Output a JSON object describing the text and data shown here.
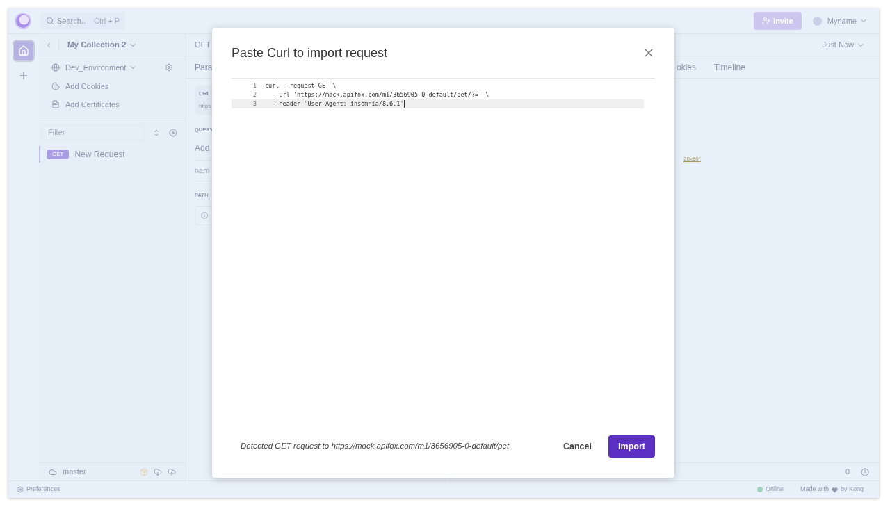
{
  "topbar": {
    "search": {
      "placeholder": "Search..",
      "shortcut": "Ctrl + P"
    },
    "invite_button": "Invite",
    "user": "Myname"
  },
  "sidebar": {
    "collection": "My Collection 2",
    "environment": "Dev_Environment",
    "links": [
      {
        "kind": "cookies",
        "label": "Add Cookies"
      },
      {
        "kind": "certificates",
        "label": "Add Certificates"
      }
    ],
    "filter": {
      "placeholder": "Filter"
    },
    "requests": [
      {
        "method": "GET",
        "name": "New Request",
        "selected": true
      }
    ],
    "branch": "master"
  },
  "request": {
    "method": "GET",
    "tab": "Para",
    "url_label": "URL",
    "url_value": "https",
    "query_label": "QUERY",
    "add": "Add",
    "name_placeholder": "nam",
    "path_label": "PATH"
  },
  "response": {
    "time": "Just Now",
    "tabs": [
      "okies",
      "Timeline"
    ],
    "body_text": "20x60\"",
    "count": "0"
  },
  "status_bar": {
    "preferences": "Preferences",
    "online": "Online",
    "made_with": "Made with",
    "by": "by Kong"
  },
  "dialog": {
    "title": "Paste Curl to import request",
    "lines": [
      {
        "number": "1",
        "code": "curl --request GET \\",
        "active": false
      },
      {
        "number": "2",
        "code": "  --url 'https://mock.apifox.com/m1/3656905-0-default/pet/?=' \\",
        "active": false
      },
      {
        "number": "3",
        "code": "  --header 'User-Agent: insomnia/8.6.1'",
        "active": true
      }
    ],
    "detected": "Detected GET request to https://mock.apifox.com/m1/3656905-0-default/pet",
    "cancel": "Cancel",
    "import": "Import"
  }
}
